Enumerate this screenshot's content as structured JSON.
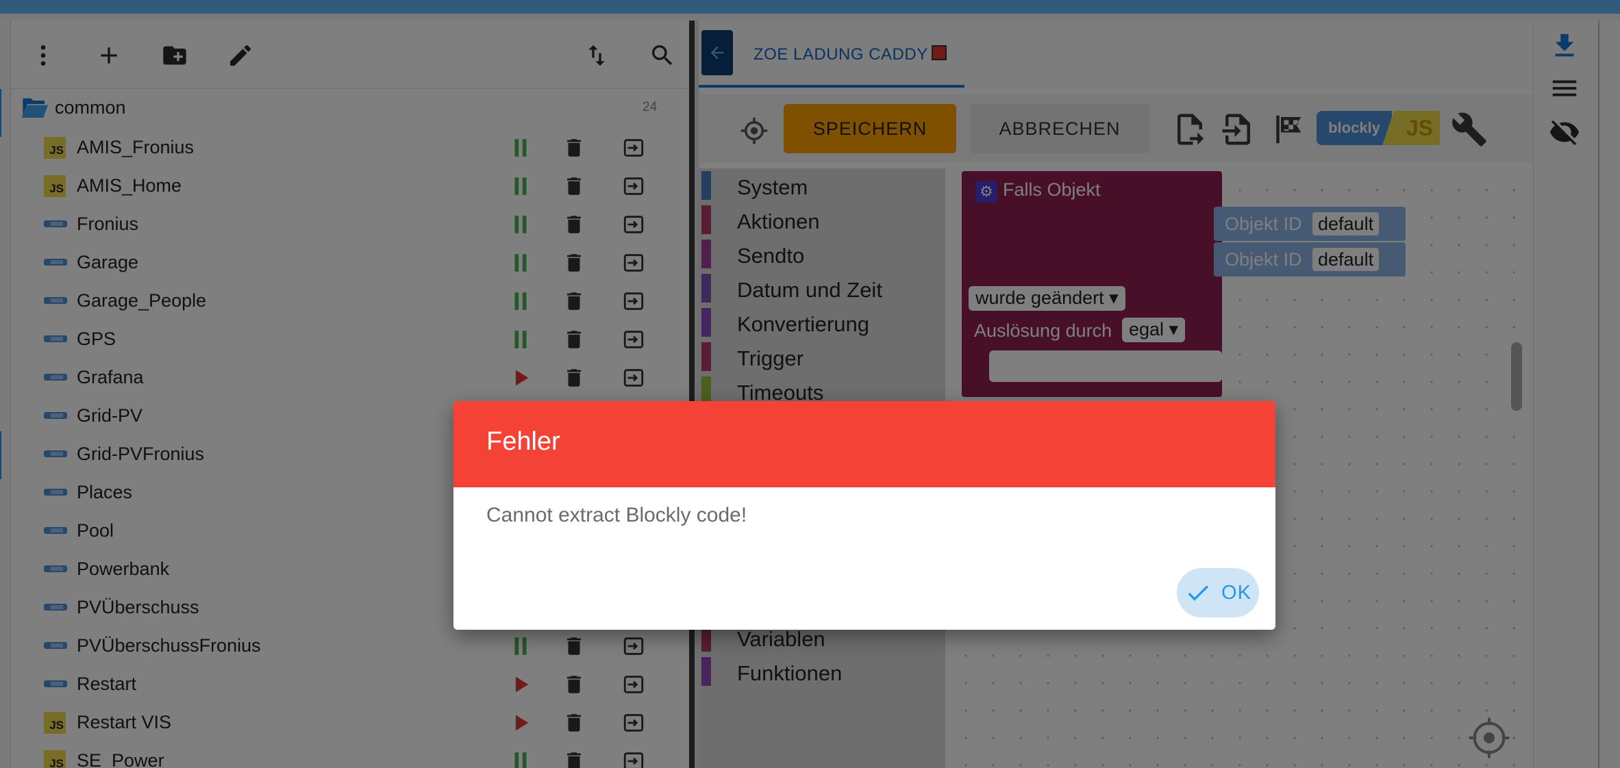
{
  "left_pane": {
    "folder": {
      "name": "common",
      "count": "24"
    },
    "scripts": [
      {
        "name": "AMIS_Fronius",
        "type": "js",
        "state": "running"
      },
      {
        "name": "AMIS_Home",
        "type": "js",
        "state": "running"
      },
      {
        "name": "Fronius",
        "type": "blockly",
        "state": "running"
      },
      {
        "name": "Garage",
        "type": "blockly",
        "state": "running"
      },
      {
        "name": "Garage_People",
        "type": "blockly",
        "state": "running"
      },
      {
        "name": "GPS",
        "type": "blockly",
        "state": "running"
      },
      {
        "name": "Grafana",
        "type": "blockly",
        "state": "stopped"
      },
      {
        "name": "Grid-PV",
        "type": "blockly",
        "state": "running"
      },
      {
        "name": "Grid-PVFronius",
        "type": "blockly",
        "state": "running"
      },
      {
        "name": "Places",
        "type": "blockly",
        "state": "running"
      },
      {
        "name": "Pool",
        "type": "blockly",
        "state": "running"
      },
      {
        "name": "Powerbank",
        "type": "blockly",
        "state": "running"
      },
      {
        "name": "PVÜberschuss",
        "type": "blockly",
        "state": "running"
      },
      {
        "name": "PVÜberschussFronius",
        "type": "blockly",
        "state": "running"
      },
      {
        "name": "Restart",
        "type": "blockly",
        "state": "stopped"
      },
      {
        "name": "Restart VIS",
        "type": "js",
        "state": "stopped"
      },
      {
        "name": "SE_Power",
        "type": "js",
        "state": "running"
      }
    ]
  },
  "editor": {
    "tab_label": "ZOE LADUNG CADDY",
    "save_label": "SPEICHERN",
    "cancel_label": "ABBRECHEN",
    "toggle_blockly": "blockly",
    "toggle_js": "JS",
    "categories": [
      {
        "label": "System",
        "color": "#4a7fc1"
      },
      {
        "label": "Aktionen",
        "color": "#b03a6a"
      },
      {
        "label": "Sendto",
        "color": "#a23f9a"
      },
      {
        "label": "Datum und Zeit",
        "color": "#7b52b8"
      },
      {
        "label": "Konvertierung",
        "color": "#8a4cc0"
      },
      {
        "label": "Trigger",
        "color": "#b03a6a"
      },
      {
        "label": "Timeouts",
        "color": "#9bbf3a"
      }
    ],
    "categories_bottom": [
      {
        "label": "Variablen",
        "color": "#b03a6a"
      },
      {
        "label": "Funktionen",
        "color": "#9146b8"
      }
    ],
    "block": {
      "title": "Falls Objekt",
      "change_dropdown": "wurde geändert",
      "trigger_label": "Auslösung durch",
      "trigger_dropdown": "egal",
      "obj_label_1": "Objekt ID",
      "obj_value_1": "default",
      "obj_label_2": "Objekt ID",
      "obj_value_2": "default"
    }
  },
  "dialog": {
    "title": "Fehler",
    "message": "Cannot extract Blockly code!",
    "ok_label": "OK"
  },
  "colors": {
    "accent": "#64b5f6",
    "error": "#f44336",
    "save": "#ffa000",
    "running": "#4caf50",
    "stopped": "#e53935"
  }
}
